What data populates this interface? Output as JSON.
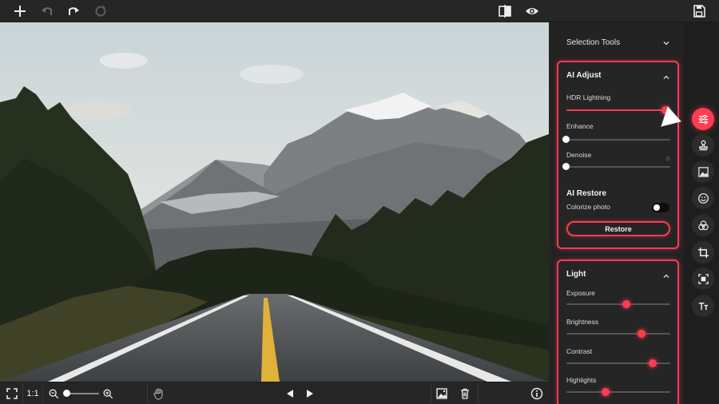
{
  "toolbar": {
    "icons": [
      "add-icon",
      "undo-icon",
      "redo-icon",
      "reset-icon",
      "compare-icon",
      "preview-eye-icon",
      "save-icon"
    ]
  },
  "bottom_bar": {
    "fit_label": "fit-screen-icon",
    "ratio_label": "1:1",
    "zoom_level": 0.05
  },
  "panel": {
    "selection_tools_label": "Selection Tools",
    "ai_adjust": {
      "title": "AI Adjust",
      "hdr_label": "HDR Lightning",
      "hdr_value": 0.95,
      "enhance_label": "Enhance",
      "enhance_value": 0,
      "denoise_label": "Denoise",
      "denoise_value_text": "0",
      "denoise_value": 0
    },
    "ai_restore": {
      "title": "AI Restore",
      "colorize_label": "Colorize photo",
      "colorize_on": false,
      "restore_label": "Restore"
    },
    "light": {
      "title": "Light",
      "exposure_label": "Exposure",
      "exposure_value": 0.58,
      "brightness_label": "Brightness",
      "brightness_value": 0.72,
      "contrast_label": "Contrast",
      "contrast_value": 0.83,
      "highlights_label": "Highlights",
      "highlights_value": 0.38
    }
  },
  "rail": {
    "icons": [
      "adjust-sliders-icon",
      "stamp-icon",
      "image-icon",
      "face-icon",
      "color-circles-icon",
      "crop-icon",
      "frame-icon",
      "text-icon"
    ],
    "active": "adjust-sliders-icon"
  },
  "colors": {
    "accent": "#ff3b4f",
    "panel_bg": "#232323",
    "toolbar_bg": "#262626"
  }
}
